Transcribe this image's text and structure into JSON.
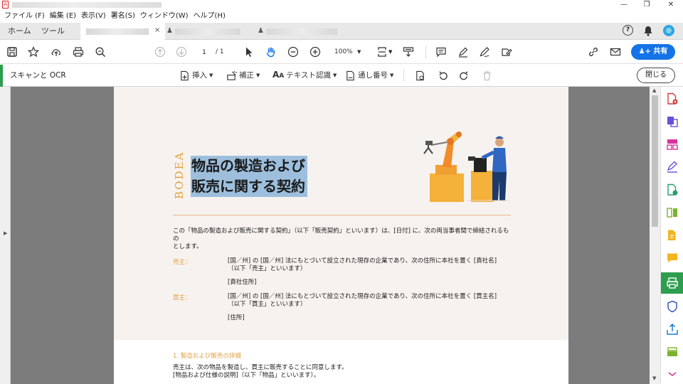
{
  "window": {
    "minimize": "—",
    "maximize": "❐",
    "close": "✕"
  },
  "menu": [
    "ファイル (F)",
    "編集 (E)",
    "表示(V)",
    "署名(S)",
    "ウィンドウ(W)",
    "ヘルプ(H)"
  ],
  "tabs": {
    "home": "ホーム",
    "tools": "ツール",
    "close": "×"
  },
  "toolbar": {
    "page_current": "1",
    "page_total": "/ 1",
    "zoom": "100%",
    "share": "共有"
  },
  "scanbar": {
    "title": "スキャンと OCR",
    "insert": "挿入",
    "enhance": "補正",
    "text_recognition": "テキスト認識",
    "bates": "通し番号",
    "close": "閉じる"
  },
  "document": {
    "brand": "BODEA",
    "title_line1": "物品の製造および",
    "title_line2": "販売に関する契約",
    "intro_line1": "この「物品の製造および販売に関する契約」（以下「販売契約」といいます）は、[日付] に、次の両当事者間で締結されるもの",
    "intro_line2": "とします。",
    "seller_label": "売主：",
    "seller_line1": "[国／州] の [国／州] 法にもとづいて設立された現存の企業であり、次の住所に本社を置く [責社名]",
    "seller_line2": "（以下「売主」といいます）",
    "seller_address": "[責社住所]",
    "buyer_label": "買主：",
    "buyer_line1": "[国／州] の [国／州] 法にもとづいて設立された現存の企業であり、次の住所に本社を置く [買主名]",
    "buyer_line2": "（以下「買主」といいます）",
    "buyer_address": "[住所]",
    "section1_heading": "1. 製造および販売の詳細",
    "section1_line1": "売主は、次の物品を製造し、買主に販売することに同意します。",
    "section1_line2": "[物品および仕様の説明]（以下「物品」といいます）。"
  },
  "colors": {
    "accent": "#1473e6",
    "scan_green": "#2d9d4e",
    "doc_orange": "#e59f3f",
    "selection": "#9dbfdd"
  }
}
